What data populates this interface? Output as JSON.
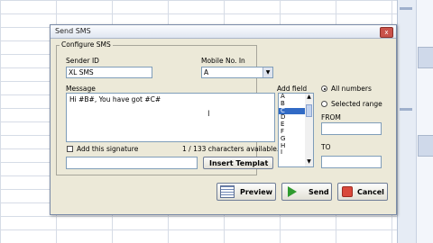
{
  "dialog": {
    "title": "Send SMS",
    "close_glyph": "x"
  },
  "configure": {
    "legend": "Configure SMS",
    "sender_label": "Sender ID",
    "sender_value": "XL SMS",
    "mobile_label": "Mobile No. In",
    "mobile_value": "A",
    "mobile_arrow": "▼",
    "message_label": "Message",
    "message_value": "Hi  #B#, You have got  #C#",
    "cursor_glyph": "I",
    "signature_label": "Add this signature",
    "char_count": "1 / 133 characters available.",
    "insert_template_label": "Insert Templat"
  },
  "add_field": {
    "label": "Add field",
    "items": [
      "A",
      "B",
      "C",
      "D",
      "E",
      "F",
      "G",
      "H",
      "I"
    ],
    "selected_index": 2,
    "scroll_up": "▲",
    "scroll_down": "▼"
  },
  "range": {
    "all_numbers_label": "All numbers",
    "selected_range_label": "Selected range",
    "from_label": "FROM",
    "to_label": "TO"
  },
  "buttons": {
    "preview": "Preview",
    "send": "Send",
    "cancel": "Cancel"
  }
}
